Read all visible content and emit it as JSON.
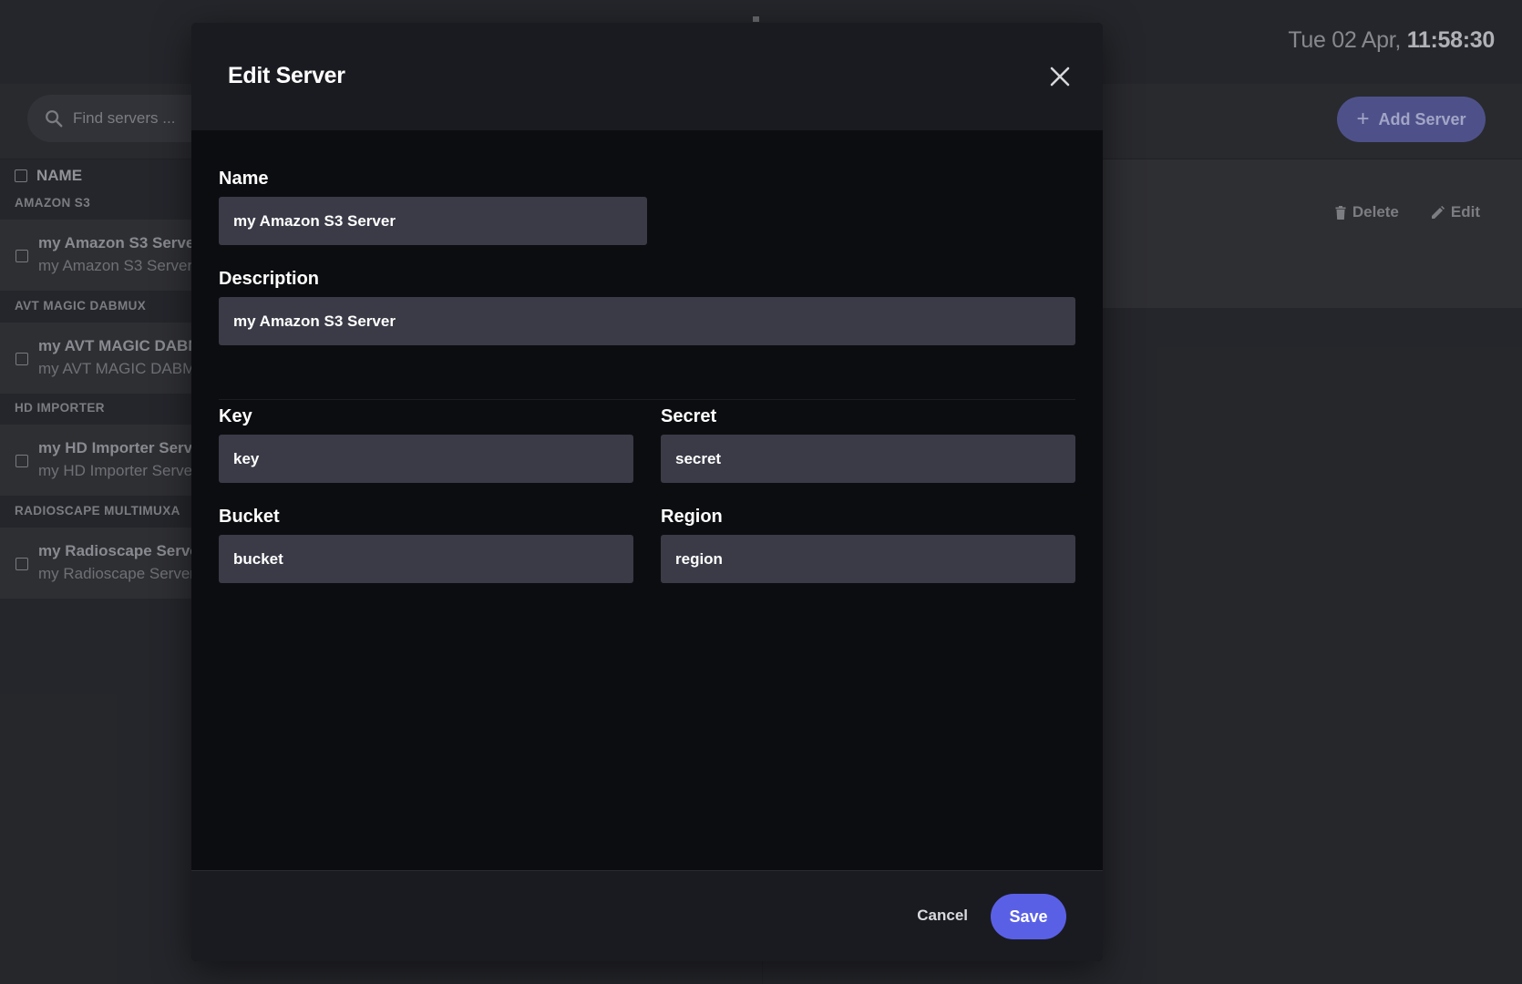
{
  "clock": {
    "date": "Tue 02 Apr,",
    "time": "11:58:30"
  },
  "toolbar": {
    "search_placeholder": "Find servers ...",
    "add_server_label": "Add Server",
    "add_icon": "plus-icon"
  },
  "list": {
    "header": "NAME",
    "groups": [
      {
        "label": "AMAZON S3",
        "title": "my Amazon S3 Server",
        "subtitle": "my Amazon S3 Server"
      },
      {
        "label": "AVT MAGIC DABMUX",
        "title": "my AVT MAGIC DABMUX Server",
        "subtitle": "my AVT MAGIC DABMUX Server"
      },
      {
        "label": "HD IMPORTER",
        "title": "my HD Importer Server",
        "subtitle": "my HD Importer Server"
      },
      {
        "label": "RADIOSCAPE MULTIMUXA",
        "title": "my Radioscape Server",
        "subtitle": "my Radioscape Server"
      }
    ]
  },
  "detail": {
    "delete_label": "Delete",
    "edit_label": "Edit"
  },
  "modal": {
    "title": "Edit Server",
    "fields": {
      "name": {
        "label": "Name",
        "value": "my Amazon S3 Server"
      },
      "description": {
        "label": "Description",
        "value": "my Amazon S3 Server"
      },
      "key": {
        "label": "Key",
        "value": "key"
      },
      "secret": {
        "label": "Secret",
        "value": "secret"
      },
      "bucket": {
        "label": "Bucket",
        "value": "bucket"
      },
      "region": {
        "label": "Region",
        "value": "region"
      }
    },
    "cancel_label": "Cancel",
    "save_label": "Save"
  },
  "colors": {
    "accent": "#5a60e6",
    "modal_bg": "#0c0d10",
    "input_bg": "#3a3b47"
  }
}
